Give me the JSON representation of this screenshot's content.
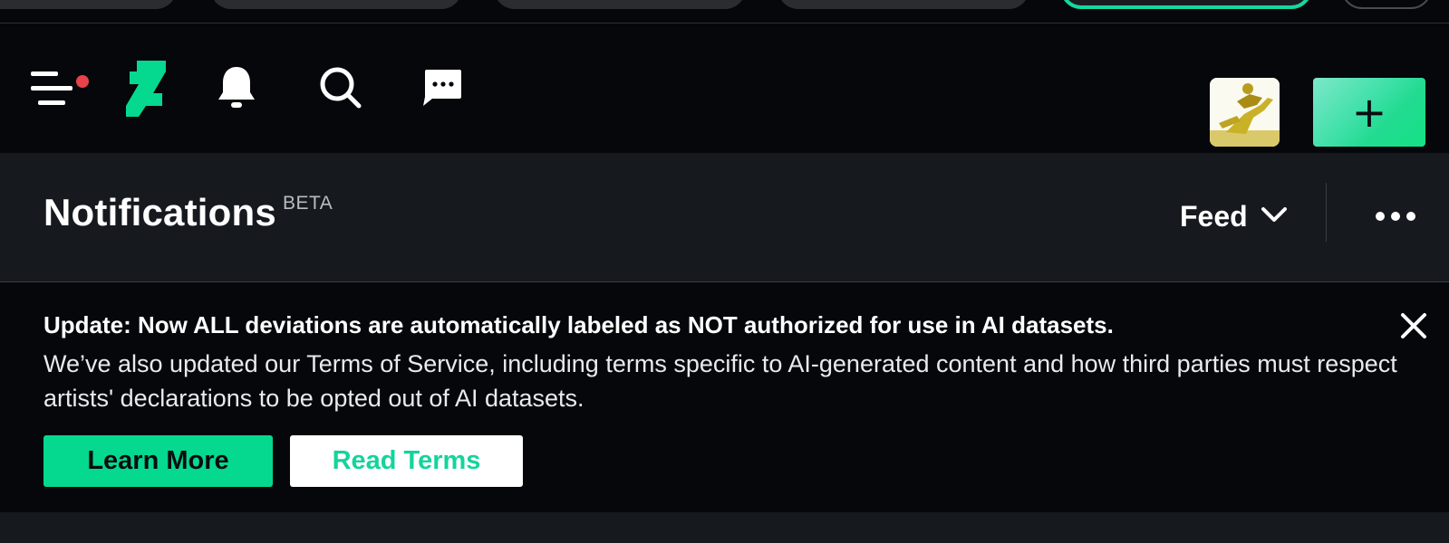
{
  "top_tabs": {
    "count": 6
  },
  "nav": {
    "icons": [
      "menu-icon",
      "deviantart-logo-icon",
      "bell-icon",
      "search-icon",
      "chat-icon"
    ],
    "menu_has_alert": true,
    "create_label": "+"
  },
  "header": {
    "title": "Notifications",
    "badge": "BETA",
    "feed_label": "Feed",
    "more_icon": "more-horizontal-icon"
  },
  "banner": {
    "headline": "Update: Now ALL deviations are automatically labeled as NOT authorized for use in AI datasets.",
    "body": "We’ve also updated our Terms of Service, including terms specific to AI-generated content and how third parties must respect artists' declarations to be opted out of AI datasets.",
    "primary_button": "Learn More",
    "secondary_button": "Read Terms",
    "close_icon": "close-icon"
  },
  "colors": {
    "accent": "#05d98f",
    "alert_dot": "#e8414a",
    "background": "#06070b",
    "panel": "#16191e"
  }
}
